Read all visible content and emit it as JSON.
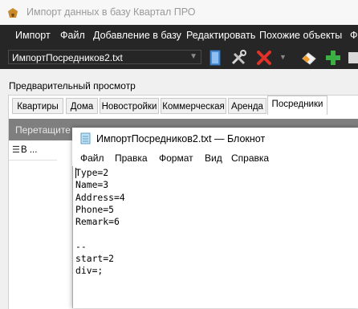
{
  "window": {
    "title": "Импорт данных в базу Квартал ПРО"
  },
  "menu": [
    "Импорт",
    "Файл",
    "Добавление в базу",
    "Редактировать",
    "Похожие объекты",
    "Фо"
  ],
  "toolbar": {
    "file_combo_value": "ИмпортПосредников2.txt"
  },
  "preview": {
    "label": "Предварительный просмотр",
    "tabs": [
      "Квартиры",
      "Дома",
      "Новостройки",
      "Коммерческая",
      "Аренда",
      "Посредники"
    ],
    "active_tab": "Посредники",
    "drag_hint": "Перетащите з",
    "grid_column_label": "В ..."
  },
  "notepad": {
    "title": "ИмпортПосредников2.txt — Блокнот",
    "menu": [
      "Файл",
      "Правка",
      "Формат",
      "Вид",
      "Справка"
    ],
    "content": "Type=2\nName=3\nAddress=4\nPhone=5\nRemark=6\n\n--\nstart=2\ndiv=;"
  },
  "colors": {
    "menubar_bg": "#262626",
    "accent_green": "#3cb043",
    "delete_red": "#e0322a"
  }
}
